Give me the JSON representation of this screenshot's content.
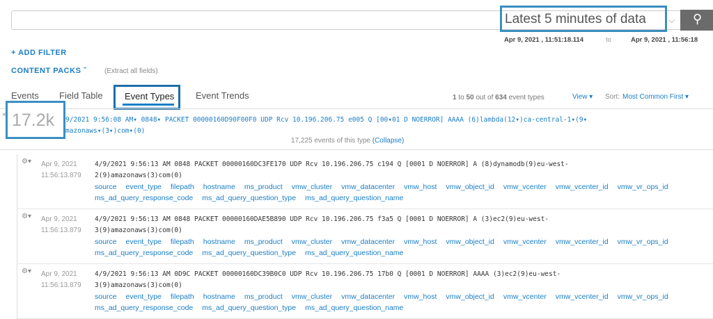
{
  "search": {
    "time_range": "Latest 5 minutes of data",
    "from": "Apr 9, 2021 , 11:51:18.114",
    "to_label": "to",
    "to": "Apr 9, 2021 , 11:56:18"
  },
  "add_filter": "+ ADD FILTER",
  "content_packs": "CONTENT PACKS ˇ",
  "extract": "(Extract all fields)",
  "tabs": [
    "Events",
    "Field Table",
    "Event Types",
    "Event Trends"
  ],
  "paging": {
    "a": "1",
    "b": " to ",
    "c": "50",
    "d": " out of ",
    "e": "634",
    "f": " event types"
  },
  "view": "View ▾",
  "sort_label": "Sort:",
  "sort_value": "Most Common First ▾",
  "event_type": {
    "count": "17.2k",
    "line1": "9/2021 9:56:08 AM▾ 0848▾ PACKET  00000160D90F00F0 UDP Rcv 10.196.206.75   e005   Q [00▾01   D   NOERROR] AAAA   (6)lambda(12▾)ca-central-1▾(9▾",
    "line2": "mazonaws▾(3▾)com▾(0)",
    "summary": "17,225 events of this type",
    "collapse": "(Collapse)"
  },
  "fields": [
    "source",
    "event_type",
    "filepath",
    "hostname",
    "ms_product",
    "vmw_cluster",
    "vmw_datacenter",
    "vmw_host",
    "vmw_object_id",
    "vmw_vcenter",
    "vmw_vcenter_id",
    "vmw_vr_ops_id",
    "ms_ad_query_response_code",
    "ms_ad_query_question_type",
    "ms_ad_query_question_name"
  ],
  "events": [
    {
      "date": "Apr 9, 2021",
      "time": "11:56:13.879",
      "line1": "4/9/2021 9:56:13 AM 0848 PACKET  00000160DC3FE170 UDP Rcv 10.196.206.75   c194   Q [0001   D   NOERROR] A      (8)dynamodb(9)eu-west-",
      "line2": "2(9)amazonaws(3)com(0)"
    },
    {
      "date": "Apr 9, 2021",
      "time": "11:56:13.879",
      "line1": "4/9/2021 9:56:13 AM 0848 PACKET  00000160DAE5B890 UDP Rcv 10.196.206.75   f3a5   Q [0001   D   NOERROR] A      (3)ec2(9)eu-west-",
      "line2": "3(9)amazonaws(3)com(0)"
    },
    {
      "date": "Apr 9, 2021",
      "time": "11:56:13.879",
      "line1": "4/9/2021 9:56:13 AM 0D9C PACKET  00000160DC39B0C0 UDP Rcv 10.196.206.75   17b0   Q [0001   D   NOERROR] AAAA   (3)ec2(9)eu-west-",
      "line2": "3(9)amazonaws(3)com(0)"
    }
  ]
}
